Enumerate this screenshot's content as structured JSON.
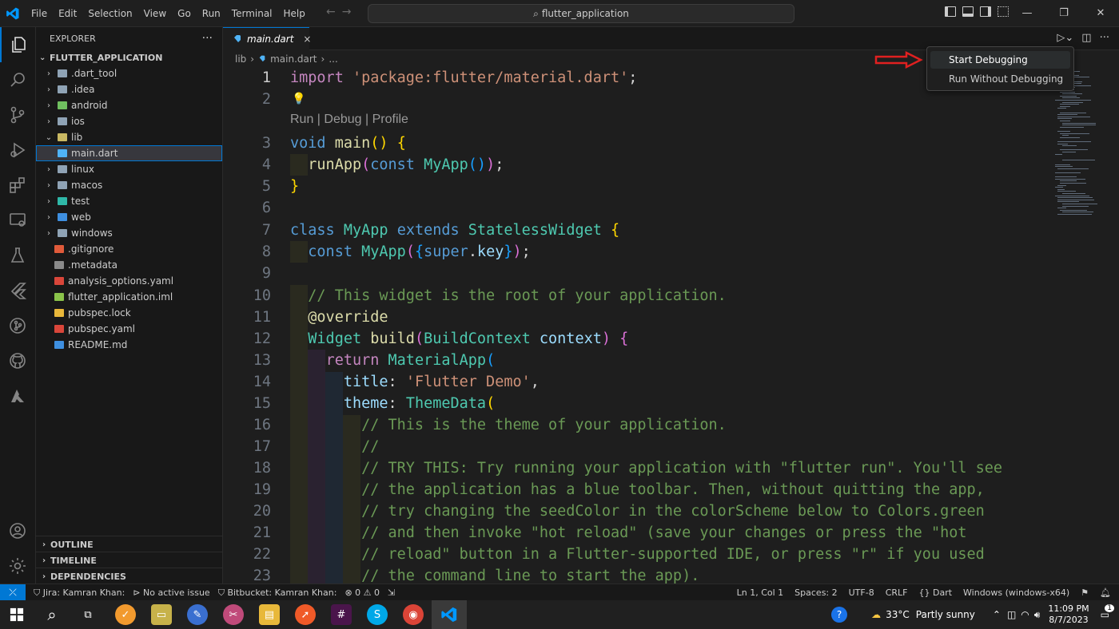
{
  "titlebar": {
    "menu": [
      "File",
      "Edit",
      "Selection",
      "View",
      "Go",
      "Run",
      "Terminal",
      "Help"
    ],
    "search_text": "flutter_application"
  },
  "explorer": {
    "title": "EXPLORER",
    "more": "···",
    "folder": "FLUTTER_APPLICATION",
    "items": [
      {
        "name": ".dart_tool",
        "chev": "›",
        "color": "#8fa3b5"
      },
      {
        "name": ".idea",
        "chev": "›",
        "color": "#8fa3b5"
      },
      {
        "name": "android",
        "chev": "›",
        "color": "#6fbf5f"
      },
      {
        "name": "ios",
        "chev": "›",
        "color": "#8fa3b5"
      },
      {
        "name": "lib",
        "chev": "⌄",
        "color": "#c9b862"
      },
      {
        "name": "main.dart",
        "chev": "",
        "color": "#4fb3f6"
      },
      {
        "name": "linux",
        "chev": "›",
        "color": "#8fa3b5"
      },
      {
        "name": "macos",
        "chev": "›",
        "color": "#8fa3b5"
      },
      {
        "name": "test",
        "chev": "›",
        "color": "#2fb8a8"
      },
      {
        "name": "web",
        "chev": "›",
        "color": "#3e8fe0"
      },
      {
        "name": "windows",
        "chev": "›",
        "color": "#8fa3b5"
      },
      {
        "name": ".gitignore",
        "chev": "",
        "color": "#e05a3a"
      },
      {
        "name": ".metadata",
        "chev": "",
        "color": "#8a8a8a"
      },
      {
        "name": "analysis_options.yaml",
        "chev": "",
        "color": "#d9463a"
      },
      {
        "name": "flutter_application.iml",
        "chev": "",
        "color": "#8ac34a"
      },
      {
        "name": "pubspec.lock",
        "chev": "",
        "color": "#e8b73a"
      },
      {
        "name": "pubspec.yaml",
        "chev": "",
        "color": "#d9463a"
      },
      {
        "name": "README.md",
        "chev": "",
        "color": "#3e8fe0"
      }
    ],
    "bottom_sections": [
      "OUTLINE",
      "TIMELINE",
      "DEPENDENCIES"
    ]
  },
  "editor": {
    "tab_label": "main.dart",
    "tab_close": "×",
    "breadcrumb": [
      "lib",
      "›",
      "main.dart",
      "›",
      "..."
    ],
    "codelens": "Run | Debug | Profile",
    "line_numbers": [
      "1",
      "2",
      "3",
      "4",
      "5",
      "6",
      "7",
      "8",
      "9",
      "10",
      "11",
      "12",
      "13",
      "14",
      "15",
      "16",
      "17",
      "18",
      "19",
      "20",
      "21",
      "22",
      "23"
    ]
  },
  "debug_menu": {
    "start": "Start Debugging",
    "run_without": "Run Without Debugging"
  },
  "statusbar": {
    "jira": "Jira: Kamran Khan:",
    "issue": "No active issue",
    "bitbucket": "Bitbucket: Kamran Khan:",
    "problems": "⊗ 0 ⚠ 0",
    "position": "Ln 1, Col 1",
    "spaces": "Spaces: 2",
    "encoding": "UTF-8",
    "eol": "CRLF",
    "language": "{} Dart",
    "device": "Windows (windows-x64)"
  },
  "taskbar": {
    "temperature": "33°C",
    "weather": "Partly sunny",
    "time": "11:09 PM",
    "date": "8/7/2023",
    "notif_count": "1"
  }
}
